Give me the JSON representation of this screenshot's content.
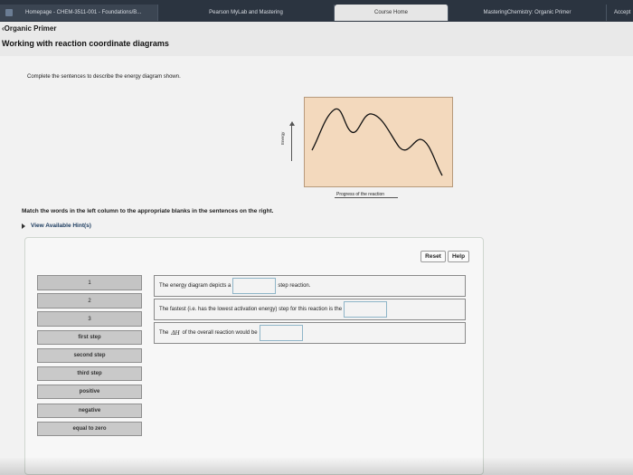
{
  "tabs": [
    {
      "label": "Homepage - CHEM-3511-001 - Foundations/B..."
    },
    {
      "label": "Pearson MyLab and Mastering"
    },
    {
      "label": "Course Home"
    },
    {
      "label": "MasteringChemistry: Organic Primer"
    },
    {
      "label": "Accept"
    }
  ],
  "nav": {
    "back_label": "‹Organic Primer"
  },
  "page": {
    "title": "Working with reaction coordinate diagrams"
  },
  "question": {
    "instruction": "Complete the sentences to describe the energy diagram shown."
  },
  "diagram": {
    "ylabel": "Energy",
    "xlabel": "Progress of the reaction"
  },
  "matching": {
    "instruction": "Match the words in the left column to the appropriate blanks in the sentences on the right.",
    "hints_label": "View Available Hint(s)",
    "reset_label": "Reset",
    "help_label": "Help",
    "numbered_slots": [
      "1",
      "2",
      "3"
    ],
    "options": [
      "first step",
      "second step",
      "third step",
      "positive",
      "negative",
      "equal to zero"
    ],
    "sentences": {
      "s1_pre": "The energy diagram depicts a",
      "s1_post": "step reaction.",
      "s2_pre": "The fastest (i.e. has the lowest activation energy) step for this reaction is the",
      "s3_pre": "The",
      "s3_delta": "ΔH",
      "s3_post": "of the overall reaction would be"
    }
  }
}
